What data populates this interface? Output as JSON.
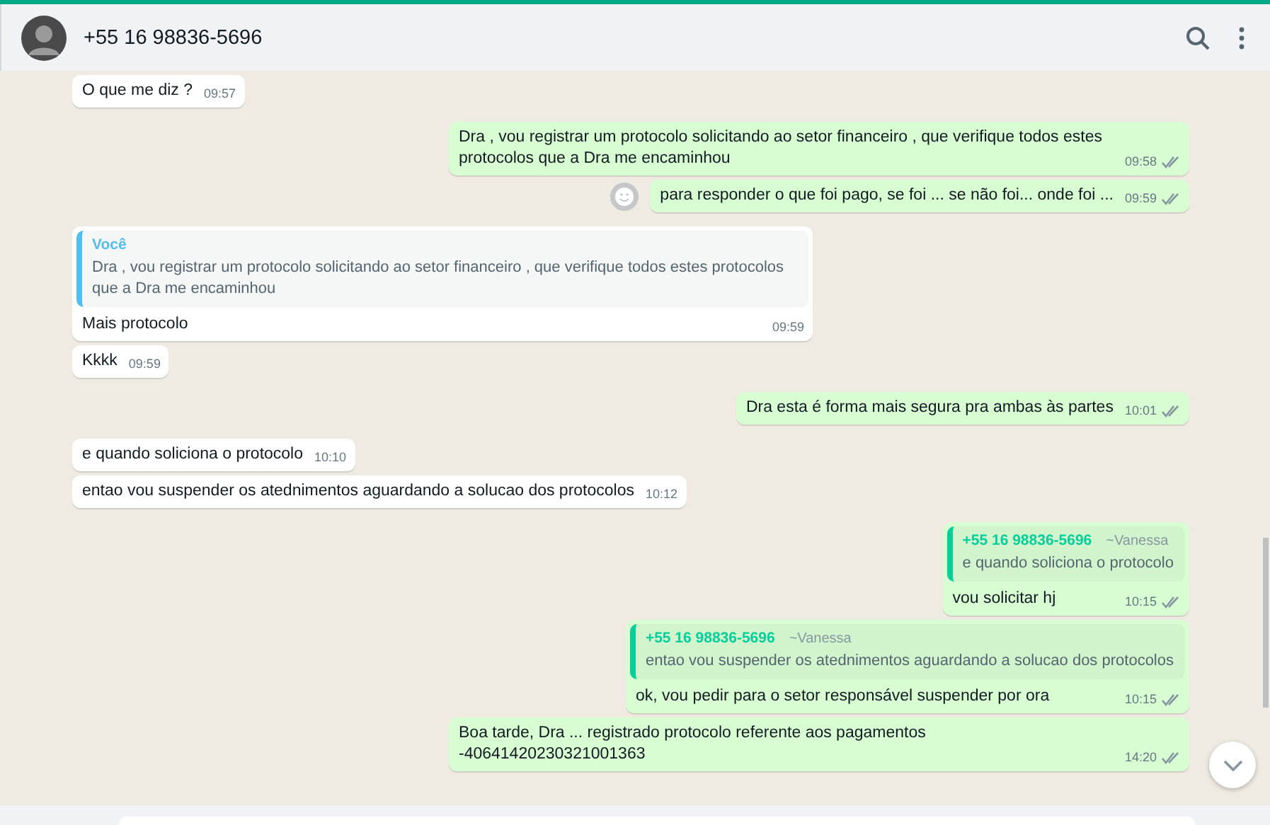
{
  "header": {
    "title": "+55 16 98836-5696"
  },
  "messages": [
    {
      "kind": "in",
      "text": "O que me diz ?",
      "time": "09:57"
    },
    {
      "kind": "out",
      "text": "Dra , vou registrar um protocolo solicitando ao setor financeiro , que verifique todos estes protocolos que a Dra me encaminhou",
      "time": "09:58",
      "group_start": true
    },
    {
      "kind": "out",
      "text": "para responder o que foi pago, se foi ... se não foi... onde foi ...",
      "time": "09:59",
      "react_button": true
    },
    {
      "kind": "in",
      "text": "Mais protocolo",
      "time": "09:59",
      "group_start": true,
      "quote": {
        "kind": "self",
        "author": "Você",
        "text": "Dra , vou registrar um protocolo solicitando ao setor financeiro , que verifique todos estes protocolos que a Dra me encaminhou"
      }
    },
    {
      "kind": "in",
      "text": "Kkkk",
      "time": "09:59"
    },
    {
      "kind": "out",
      "text": "Dra esta é forma mais segura pra ambas às partes",
      "time": "10:01",
      "group_start": true
    },
    {
      "kind": "in",
      "text": "e quando soliciona o protocolo",
      "time": "10:10",
      "group_start": true
    },
    {
      "kind": "in",
      "text": "entao vou suspender os atednimentos aguardando a solucao dos protocolos",
      "time": "10:12"
    },
    {
      "kind": "out",
      "text": "vou solicitar hj",
      "time": "10:15",
      "group_start": true,
      "quote": {
        "kind": "contact",
        "author": "+55 16 98836-5696",
        "alias": "~Vanessa",
        "text": "e quando soliciona o protocolo"
      }
    },
    {
      "kind": "out",
      "text": "ok, vou pedir para o setor responsável suspender por ora",
      "time": "10:15",
      "quote": {
        "kind": "contact",
        "author": "+55 16 98836-5696",
        "alias": "~Vanessa",
        "text": "entao vou suspender os atednimentos aguardando a solucao dos protocolos"
      }
    },
    {
      "kind": "out",
      "text": "Boa tarde, Dra ... registrado protocolo referente aos pagamentos -40641420230321001363",
      "time": "14:20"
    }
  ]
}
